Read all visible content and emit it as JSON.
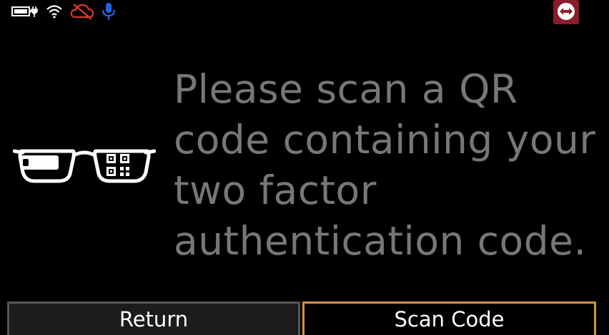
{
  "status_bar": {
    "icons": [
      "battery-charging-icon",
      "wifi-icon",
      "cloud-off-icon",
      "microphone-icon"
    ],
    "colors": {
      "battery": "#ffffff",
      "wifi": "#ffffff",
      "cloud_off": "#d63a2a",
      "microphone": "#1e64e6"
    },
    "remote_app_icon": "remote-control-app-icon",
    "remote_app_color": "#8a1c2c"
  },
  "illustration": {
    "icon": "smart-glasses-qr-icon"
  },
  "message": "Please scan a QR code containing your two factor authentication code.",
  "buttons": {
    "return_label": "Return",
    "scan_label": "Scan Code"
  },
  "colors": {
    "background": "#000000",
    "message_text": "#777777",
    "button_text": "#ffffff",
    "scan_border": "#d4904a",
    "return_border": "#555555"
  }
}
